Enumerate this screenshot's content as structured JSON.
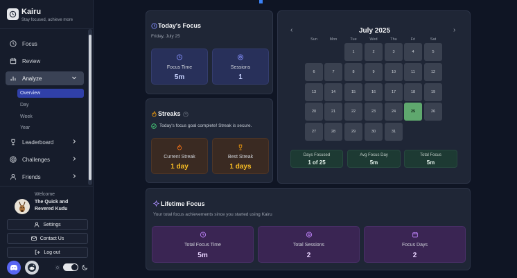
{
  "brand": {
    "title": "Kairu",
    "subtitle": "Stay focused, achieve more"
  },
  "nav": {
    "focus": "Focus",
    "review": "Review",
    "analyze": "Analyze",
    "analyze_sub": [
      "Overview",
      "Day",
      "Week",
      "Year"
    ],
    "leaderboard": "Leaderboard",
    "challenges": "Challenges",
    "friends": "Friends"
  },
  "user": {
    "welcome": "Welcome",
    "name": "The Quick and Revered Kudu"
  },
  "buttons": {
    "settings": "Settings",
    "contact": "Contact Us",
    "logout": "Log out"
  },
  "today": {
    "title": "Today's Focus",
    "date": "Friday, July 25",
    "focus_time_label": "Focus Time",
    "focus_time_value": "5m",
    "sessions_label": "Sessions",
    "sessions_value": "1"
  },
  "streaks": {
    "title": "Streaks",
    "message": "Today's focus goal complete! Streak is secure.",
    "current_label": "Current Streak",
    "current_value": "1 day",
    "best_label": "Best Streak",
    "best_value": "1 days"
  },
  "calendar": {
    "month": "July 2025",
    "prev": "‹",
    "next": "›",
    "weekdays": [
      "Sun",
      "Mon",
      "Tue",
      "Wed",
      "Thu",
      "Fri",
      "Sat"
    ],
    "days": [
      "1",
      "2",
      "3",
      "4",
      "5",
      "6",
      "7",
      "8",
      "9",
      "10",
      "11",
      "12",
      "13",
      "14",
      "15",
      "16",
      "17",
      "18",
      "19",
      "20",
      "21",
      "22",
      "23",
      "24",
      "25",
      "26",
      "27",
      "28",
      "29",
      "30",
      "31"
    ],
    "first_weekday": 2,
    "today": 25,
    "days_focused_label": "Days Focused",
    "days_focused_value": "1 of 25",
    "avg_label": "Avg Focus Day",
    "avg_value": "5m",
    "total_label": "Total Focus",
    "total_value": "5m"
  },
  "lifetime": {
    "title": "Lifetime Focus",
    "subtitle": "Your total focus achievements since you started using Kairu",
    "total_time_label": "Total Focus Time",
    "total_time_value": "5m",
    "total_sessions_label": "Total Sessions",
    "total_sessions_value": "2",
    "focus_days_label": "Focus Days",
    "focus_days_value": "2"
  },
  "colors": {
    "accent": "#3040a8",
    "today_green": "#5fa86e",
    "streak_gold": "#fbbf24"
  }
}
